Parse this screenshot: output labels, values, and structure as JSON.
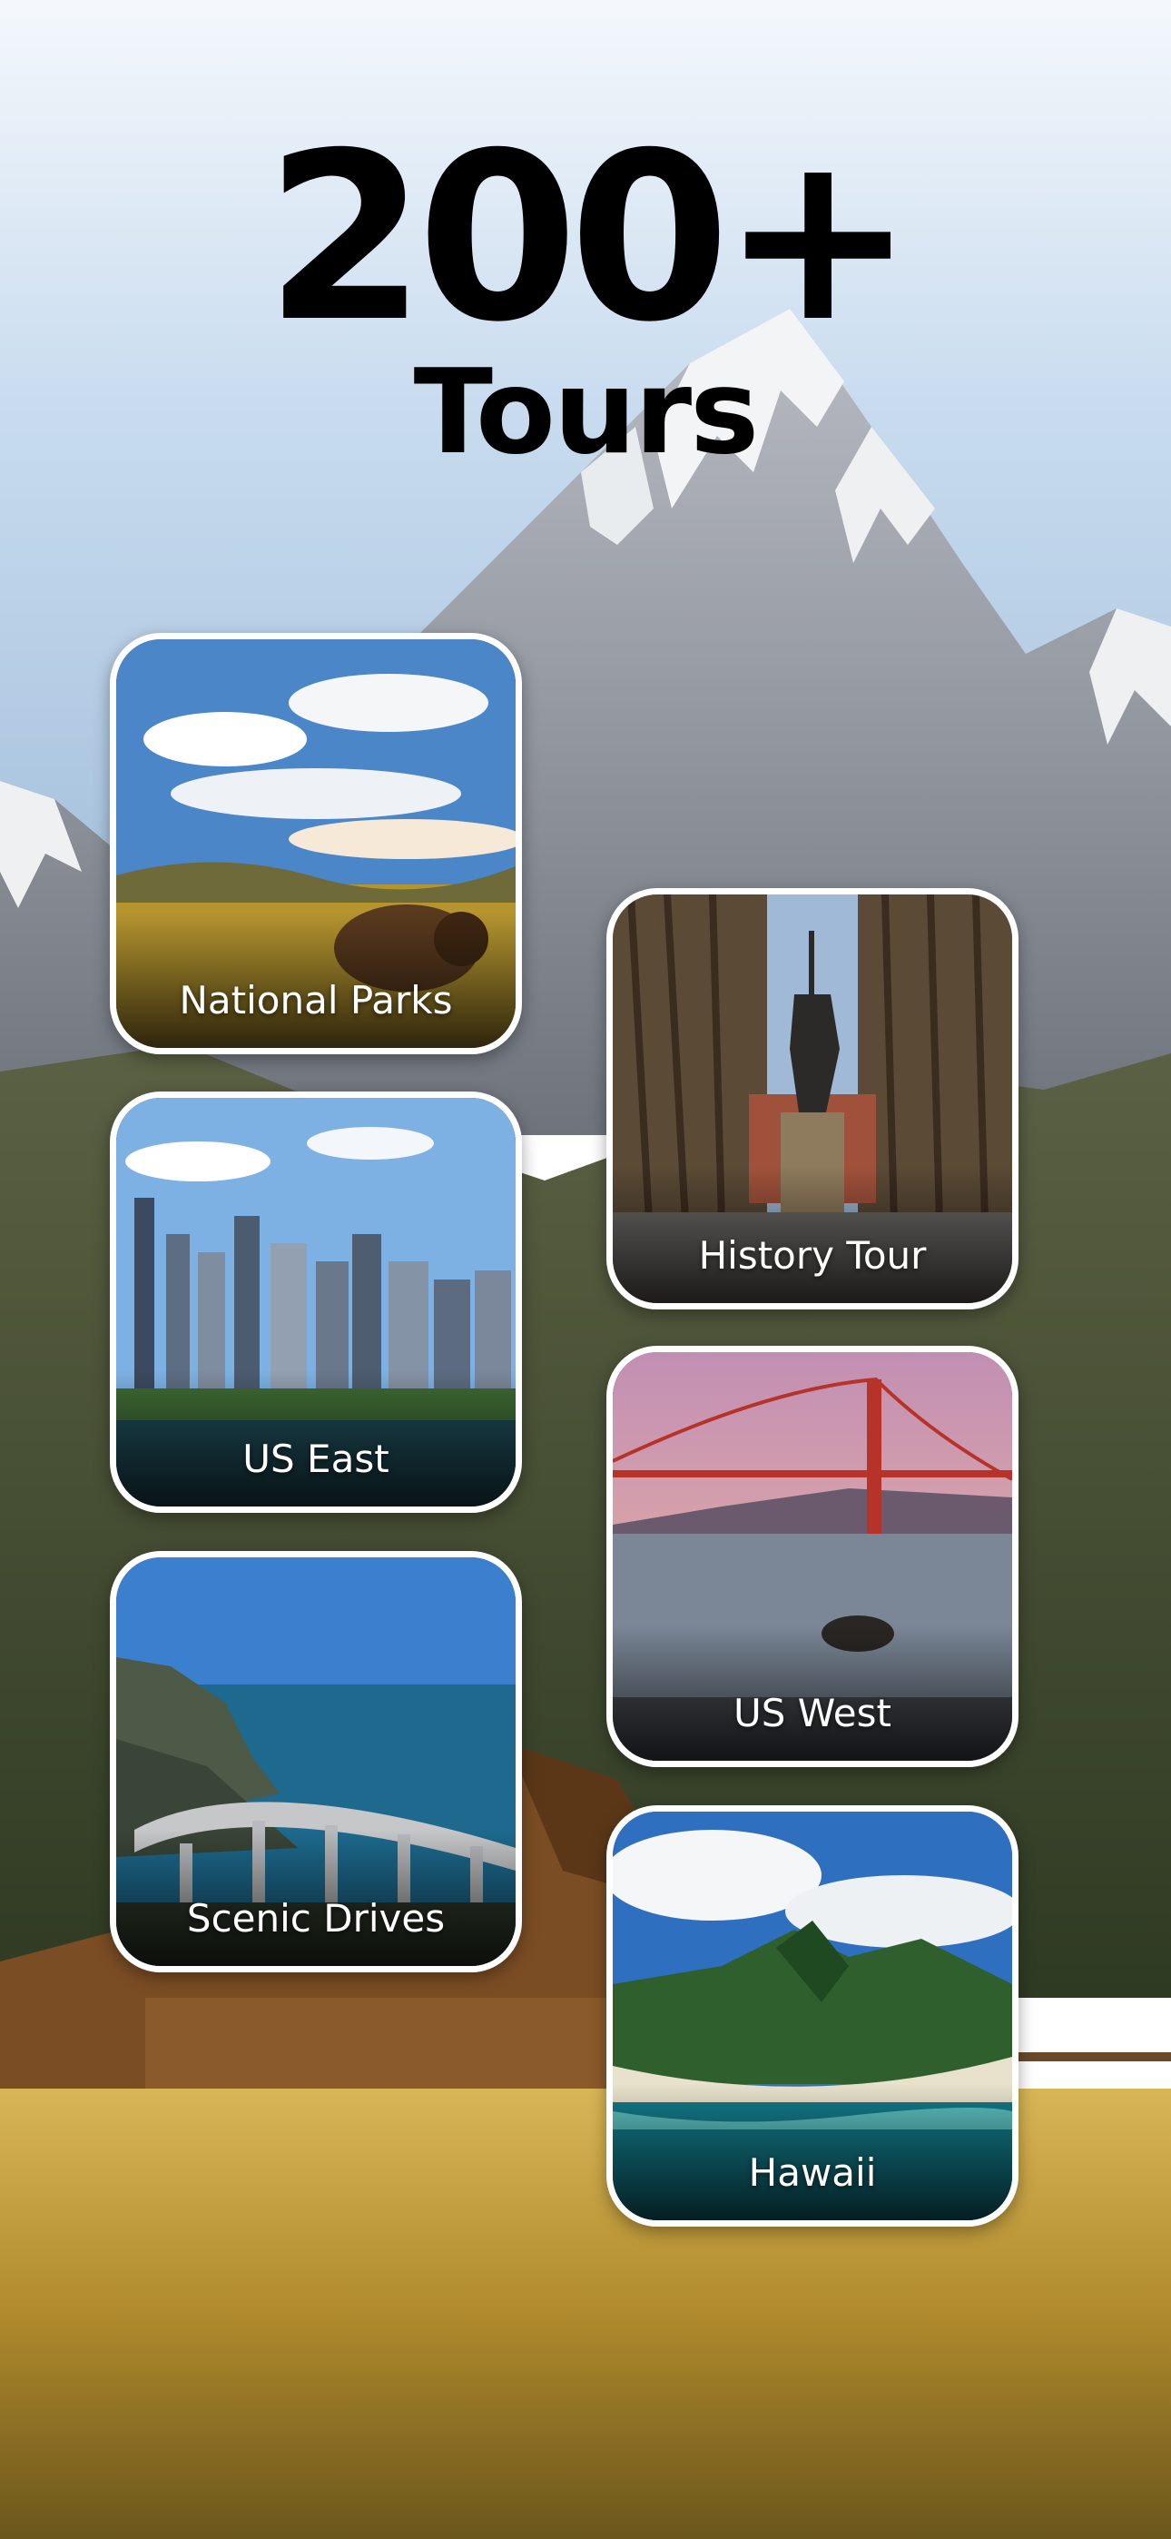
{
  "headline": {
    "count": "200+",
    "label": "Tours"
  },
  "categories": [
    {
      "id": "national-parks",
      "label": "National Parks"
    },
    {
      "id": "us-east",
      "label": "US East"
    },
    {
      "id": "scenic-drives",
      "label": "Scenic Drives"
    },
    {
      "id": "history-tour",
      "label": "History Tour"
    },
    {
      "id": "us-west",
      "label": "US West"
    },
    {
      "id": "hawaii",
      "label": "Hawaii"
    }
  ],
  "colors": {
    "sky": "#c9dcef",
    "mountain": "#8a8f98",
    "snow": "#f3f4f6",
    "forest": "#3f4a2a",
    "grass": "#c9a23e",
    "barn": "#8b5a2b",
    "card_border": "#ffffff",
    "headline": "#000000"
  }
}
